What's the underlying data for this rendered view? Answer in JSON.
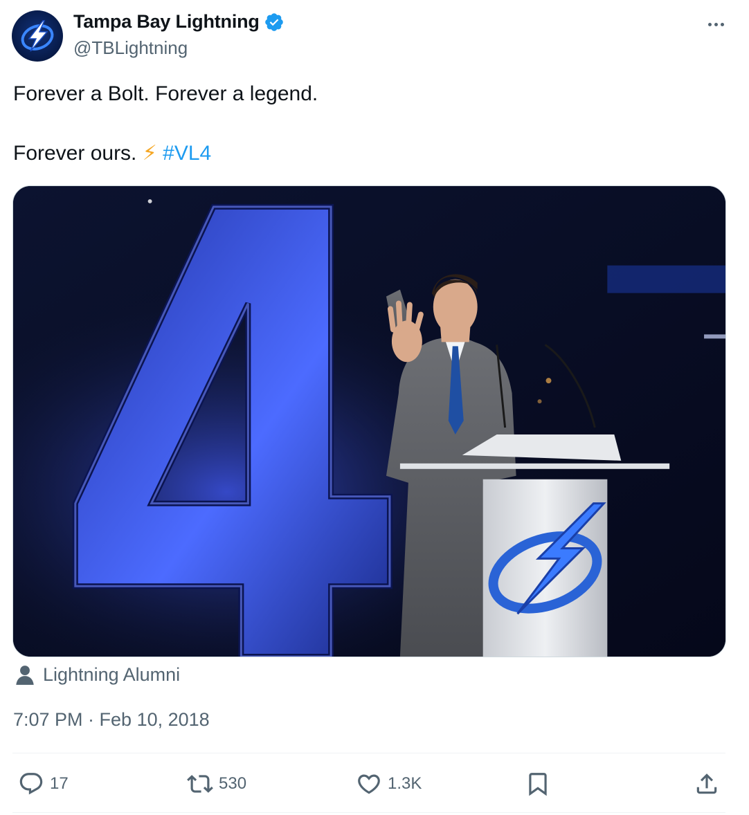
{
  "author": {
    "display_name": "Tampa Bay Lightning",
    "handle": "@TBLightning",
    "verified": true,
    "avatar_icon": "lightning-bolt-logo-icon"
  },
  "tweet": {
    "line1": "Forever a Bolt. Forever a legend.",
    "line2_text": "Forever ours. ",
    "line2_emoji": "⚡",
    "hashtag": "#VL4"
  },
  "media": {
    "jersey_number": "4"
  },
  "tagged": {
    "label": "Lightning Alumni",
    "icon": "person-icon"
  },
  "timestamp": "7:07 PM · Feb 10, 2018",
  "actions": {
    "replies": "17",
    "retweets": "530",
    "likes": "1.3K"
  },
  "colors": {
    "accent": "#1d9bf0",
    "text_primary": "#0f1419",
    "text_secondary": "#536471",
    "divider": "#eff3f4"
  }
}
